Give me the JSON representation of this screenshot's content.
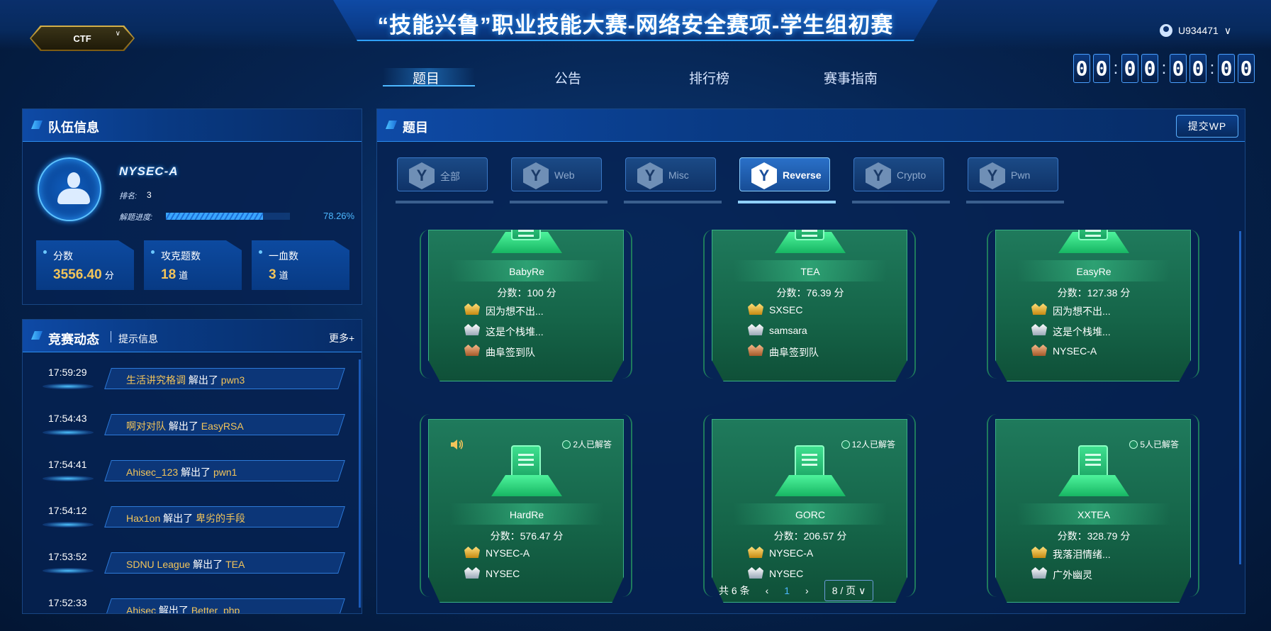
{
  "header": {
    "title": "“技能兴鲁”职业技能大赛-网络安全赛项-学生组初赛",
    "ctf_selector": "CTF",
    "username": "U934471",
    "nav": [
      "题目",
      "公告",
      "排行榜",
      "赛事指南"
    ],
    "timer": [
      "0",
      "0",
      ":",
      "0",
      "0",
      ":",
      "0",
      "0",
      ":",
      "0",
      "0"
    ]
  },
  "team": {
    "panel_title": "队伍信息",
    "name": "NYSEC-A",
    "rank_label": "排名:",
    "rank_value": "3",
    "progress_label": "解题进度:",
    "progress_pct": 78.26,
    "progress_text": "78.26%",
    "stats": [
      {
        "label": "分数",
        "value": "3556.40",
        "unit": "分"
      },
      {
        "label": "攻克题数",
        "value": "18",
        "unit": "道"
      },
      {
        "label": "一血数",
        "value": "3",
        "unit": "道"
      }
    ]
  },
  "feed": {
    "title": "竞赛动态",
    "subtitle": "提示信息",
    "more": "更多+",
    "items": [
      {
        "time": "17:59:29",
        "team": "生活讲究格调",
        "verb": "解出了",
        "challenge": "pwn3"
      },
      {
        "time": "17:54:43",
        "team": "啊对对队",
        "verb": "解出了",
        "challenge": "EasyRSA"
      },
      {
        "time": "17:54:41",
        "team": "Ahisec_123",
        "verb": "解出了",
        "challenge": "pwn1"
      },
      {
        "time": "17:54:12",
        "team": "Hax1on",
        "verb": "解出了",
        "challenge": "卑劣的手段"
      },
      {
        "time": "17:53:52",
        "team": "SDNU League",
        "verb": "解出了",
        "challenge": "TEA"
      },
      {
        "time": "17:52:33",
        "team": "Ahisec",
        "verb": "解出了",
        "challenge": "Better_php"
      }
    ]
  },
  "challenges": {
    "panel_title": "题目",
    "submit_label": "提交WP",
    "categories": [
      "全部",
      "Web",
      "Misc",
      "Reverse",
      "Crypto",
      "Pwn"
    ],
    "active_category": "Reverse",
    "cards": [
      {
        "name": "BabyRe",
        "score": "分数：100 分",
        "solvers": [
          "因为想不出...",
          "这是个栈堆...",
          "曲阜签到队"
        ]
      },
      {
        "name": "TEA",
        "score": "分数：76.39 分",
        "solvers": [
          "SXSEC",
          "samsara",
          "曲阜签到队"
        ]
      },
      {
        "name": "EasyRe",
        "score": "分数：127.38 分",
        "solvers": [
          "因为想不出...",
          "这是个栈堆...",
          "NYSEC-A"
        ]
      },
      {
        "name": "HardRe",
        "score": "分数：576.47 分",
        "solved": "2人已解答",
        "solvers": [
          "NYSEC-A",
          "NYSEC"
        ]
      },
      {
        "name": "GORC",
        "score": "分数：206.57 分",
        "solved": "12人已解答",
        "solvers": [
          "NYSEC-A",
          "NYSEC"
        ]
      },
      {
        "name": "XXTEA",
        "score": "分数：328.79 分",
        "solved": "5人已解答",
        "solvers": [
          "我落泪情绪...",
          "广外幽灵"
        ]
      }
    ],
    "pagination": {
      "total": "共 6 条",
      "prev": "‹",
      "current": "1",
      "next": "›",
      "page_size": "8 / 页"
    }
  },
  "icons": {
    "user": "user-icon",
    "chevron": "chevron-down-icon",
    "category": "y-shield-icon",
    "medal_gold": "gold-crown-icon",
    "medal_silver": "silver-crown-icon",
    "medal_bronze": "bronze-crown-icon",
    "sound": "speaker-icon"
  },
  "colors": {
    "accent": "#2fa0ff",
    "gold": "#f2c45a",
    "card_green": "#1f7a5c"
  }
}
